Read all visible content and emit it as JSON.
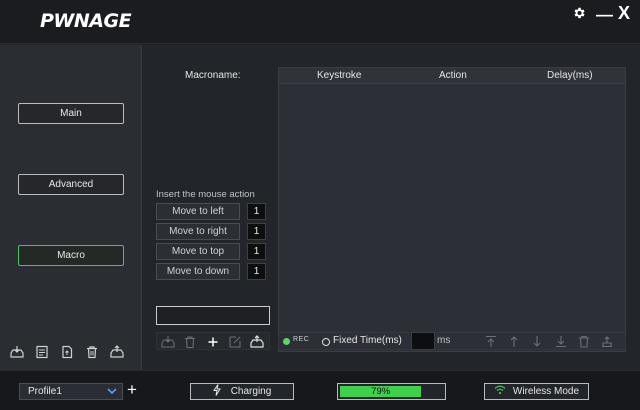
{
  "app": {
    "logo_text": "PWNAGE"
  },
  "window": {
    "settings_icon": "gear-icon",
    "minimize_glyph": "—",
    "close_glyph": "X"
  },
  "sidebar": {
    "items": [
      {
        "label": "Main",
        "active": false
      },
      {
        "label": "Advanced",
        "active": false
      },
      {
        "label": "Macro",
        "active": true
      }
    ],
    "tools": [
      "import-icon",
      "notes-icon",
      "export-file-icon",
      "trash-icon",
      "export-icon"
    ]
  },
  "macro": {
    "name_label": "Macroname:",
    "name_value": "",
    "columns": [
      "Keystroke",
      "Action",
      "Delay(ms)"
    ],
    "rows": [],
    "mouse_action_title": "Insert the mouse action",
    "mouse_actions": [
      {
        "label": "Move to left",
        "value": "1"
      },
      {
        "label": "Move to right",
        "value": "1"
      },
      {
        "label": "Move to top",
        "value": "1"
      },
      {
        "label": "Move to down",
        "value": "1"
      }
    ],
    "rec_label": "REC",
    "fixed_time_label": "Fixed Time(ms)",
    "fixed_time_value": "",
    "ms_label": "ms"
  },
  "footer": {
    "profile": "Profile1",
    "add_glyph": "+",
    "charging_label": "Charging",
    "battery_percent": 79,
    "battery_label": "79%",
    "wireless_label": "Wireless Mode"
  },
  "colors": {
    "accent": "#3fd14c",
    "rec": "#5fd46b"
  }
}
